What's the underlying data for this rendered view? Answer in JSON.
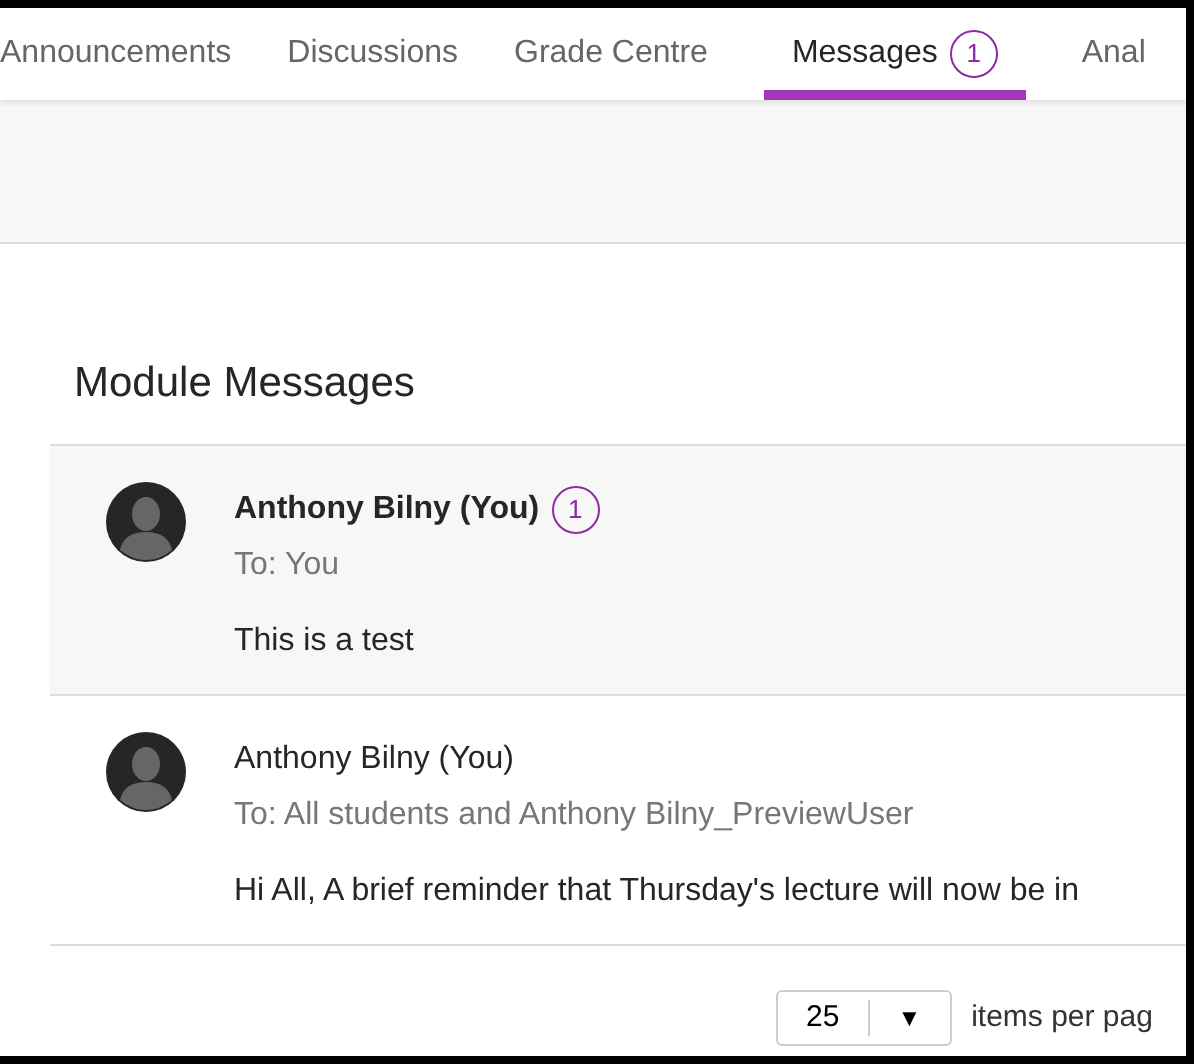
{
  "tabs": [
    {
      "label": "Announcements",
      "selected": false
    },
    {
      "label": "Discussions",
      "selected": false
    },
    {
      "label": "Grade Centre",
      "selected": false
    },
    {
      "label": "Messages",
      "selected": true,
      "badge": "1"
    },
    {
      "label": "Anal",
      "selected": false
    }
  ],
  "heading": "Module Messages",
  "messages": [
    {
      "author": "Anthony Bilny (You)",
      "badge": "1",
      "unread": true,
      "to": "To: You",
      "body": "This is a test"
    },
    {
      "author": "Anthony Bilny (You)",
      "unread": false,
      "to": "To: All students and Anthony Bilny_PreviewUser",
      "body": "Hi All, A brief reminder that Thursday's lecture will now be in"
    }
  ],
  "pagination": {
    "per_page": "25",
    "caret": "▼",
    "label": "items per pag"
  }
}
